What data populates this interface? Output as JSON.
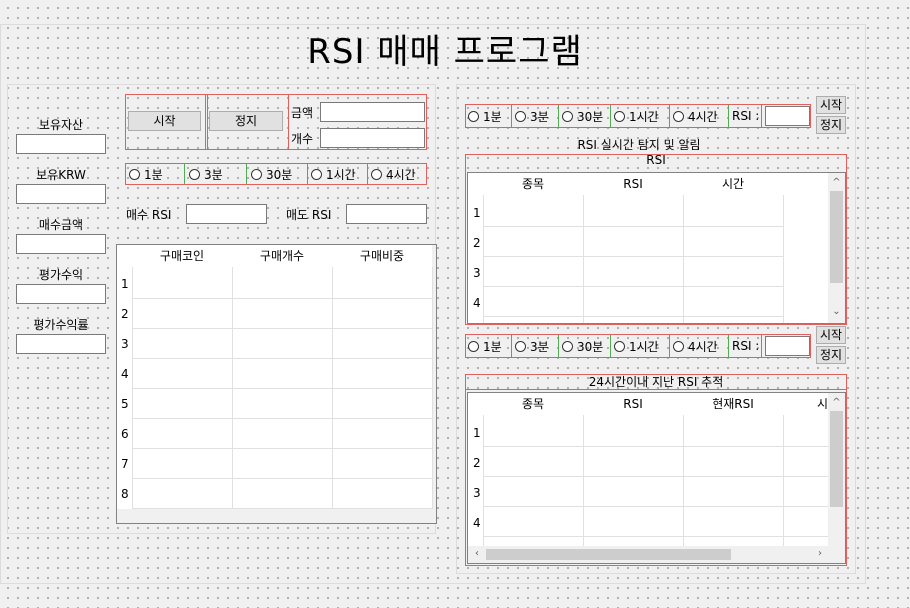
{
  "title": "RSI 매매 프로그램",
  "left_labels": [
    "보유자산",
    "보유KRW",
    "매수금액",
    "평가수익",
    "평가수익률"
  ],
  "trade": {
    "start": "시작",
    "stop": "정지",
    "amount_label": "금액",
    "count_label": "개수"
  },
  "intervals": [
    "1분",
    "3분",
    "30분",
    "1시간",
    "4시간"
  ],
  "buy_rsi_label": "매수 RSI",
  "sell_rsi_label": "매도 RSI",
  "buy_table": {
    "columns": [
      "구매코인",
      "구매개수",
      "구매비중"
    ],
    "rows": [
      "1",
      "2",
      "3",
      "4",
      "5",
      "6",
      "7",
      "8"
    ]
  },
  "rsi_top": {
    "rsi_label": "RSI :",
    "start": "시작",
    "stop": "정지",
    "section_title": "RSI 실시간 탐지 및 알림",
    "group_title": "RSI",
    "columns": [
      "종목",
      "RSI",
      "시간"
    ],
    "rows": [
      "1",
      "2",
      "3",
      "4"
    ]
  },
  "rsi_bottom": {
    "rsi_label": "RSI :",
    "start": "시작",
    "stop": "정지",
    "group_title": "24시간이내 지난 RSI 추적",
    "columns": [
      "종목",
      "RSI",
      "현재RSI",
      "시"
    ],
    "rows": [
      "1",
      "2",
      "3",
      "4"
    ]
  }
}
